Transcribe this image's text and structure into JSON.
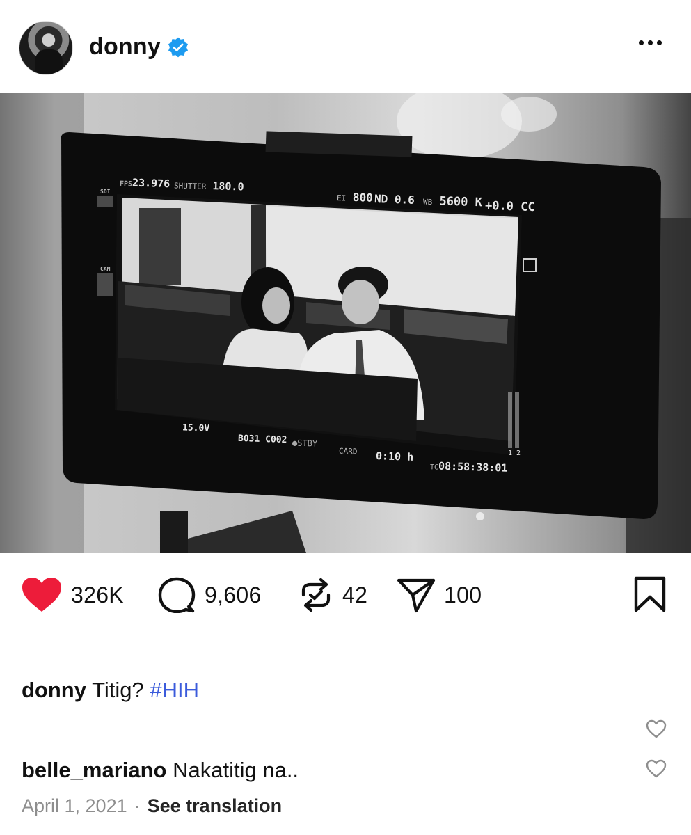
{
  "post": {
    "username": "donny",
    "verified": true,
    "verified_color": "#1d9bf0",
    "more_icon": "ellipsis-icon"
  },
  "viewfinder": {
    "fps_label": "FPS",
    "fps_value": "23.976",
    "shutter_label": "SHUTTER",
    "shutter_value": "180.0",
    "ei_label": "EI",
    "ei_value": "800",
    "nd": "ND 0.6",
    "wb_label": "WB",
    "wb_value": "5600 K",
    "cc": "+0.0 CC",
    "volt": "15.0V",
    "clip": "B031 C002",
    "stby": "●STBY",
    "card_label": "CARD",
    "card_value": "0:10 h",
    "tc_label": "TC",
    "tc_value": "08:58:38:01",
    "sdi": "SDI",
    "cam": "CAM",
    "meter_labels": "1 2"
  },
  "actions": {
    "likes": "326K",
    "comments": "9,606",
    "reposts": "42",
    "shares": "100",
    "like_color": "#ed1c3a"
  },
  "caption": {
    "user": "donny",
    "text": "Titig?",
    "hashtag": "#HIH"
  },
  "comment": {
    "user": "belle_mariano",
    "text": "Nakatitig na.."
  },
  "meta": {
    "date": "April 1, 2021",
    "separator": "·",
    "see_translation": "See translation"
  }
}
